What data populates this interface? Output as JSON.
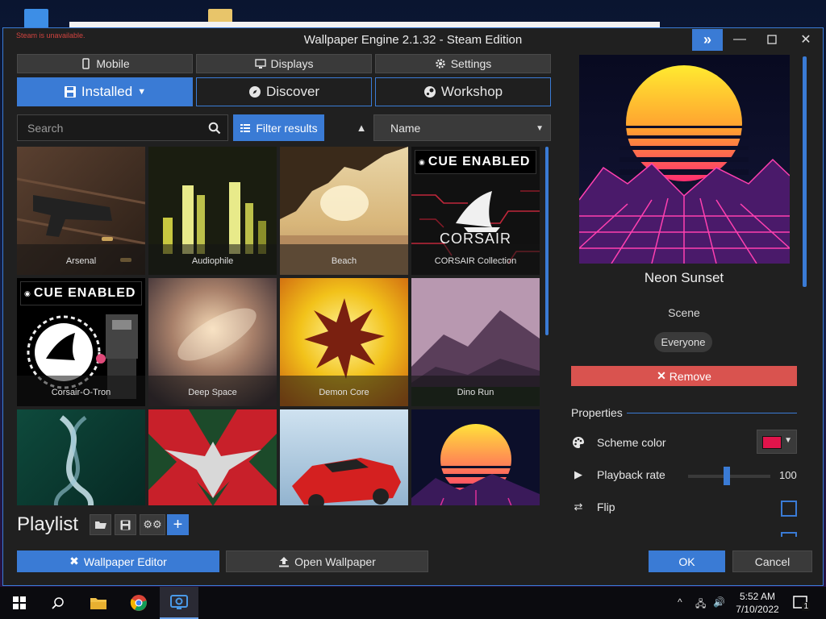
{
  "window": {
    "title": "Wallpaper Engine 2.1.32 - Steam Edition",
    "steam_warning": "Steam is unavailable."
  },
  "top_buttons": {
    "mobile": "Mobile",
    "displays": "Displays",
    "settings": "Settings"
  },
  "tabs": {
    "installed": "Installed",
    "discover": "Discover",
    "workshop": "Workshop"
  },
  "search": {
    "placeholder": "Search"
  },
  "filter": {
    "label": "Filter results"
  },
  "sort": {
    "value": "Name"
  },
  "wallpapers": [
    {
      "name": "Arsenal"
    },
    {
      "name": "Audiophile"
    },
    {
      "name": "Beach"
    },
    {
      "name": "CORSAIR Collection",
      "badge": "CUE ENABLED",
      "logo": "CORSAIR"
    },
    {
      "name": "Corsair-O-Tron",
      "badge": "CUE ENABLED"
    },
    {
      "name": "Deep Space"
    },
    {
      "name": "Demon Core"
    },
    {
      "name": "Dino Run"
    },
    {
      "name": ""
    },
    {
      "name": ""
    },
    {
      "name": ""
    },
    {
      "name": ""
    }
  ],
  "playlist": {
    "label": "Playlist"
  },
  "bottom": {
    "editor": "Wallpaper Editor",
    "open": "Open Wallpaper",
    "ok": "OK",
    "cancel": "Cancel"
  },
  "details": {
    "title": "Neon Sunset",
    "type": "Scene",
    "rating": "Everyone",
    "remove": "Remove"
  },
  "properties": {
    "heading": "Properties",
    "scheme_color": {
      "label": "Scheme color",
      "value": "#e1144b"
    },
    "playback_rate": {
      "label": "Playback rate",
      "value": "100"
    },
    "flip": {
      "label": "Flip",
      "checked": false
    }
  },
  "taskbar": {
    "time": "5:52 AM",
    "date": "7/10/2022",
    "notifications": "1"
  }
}
